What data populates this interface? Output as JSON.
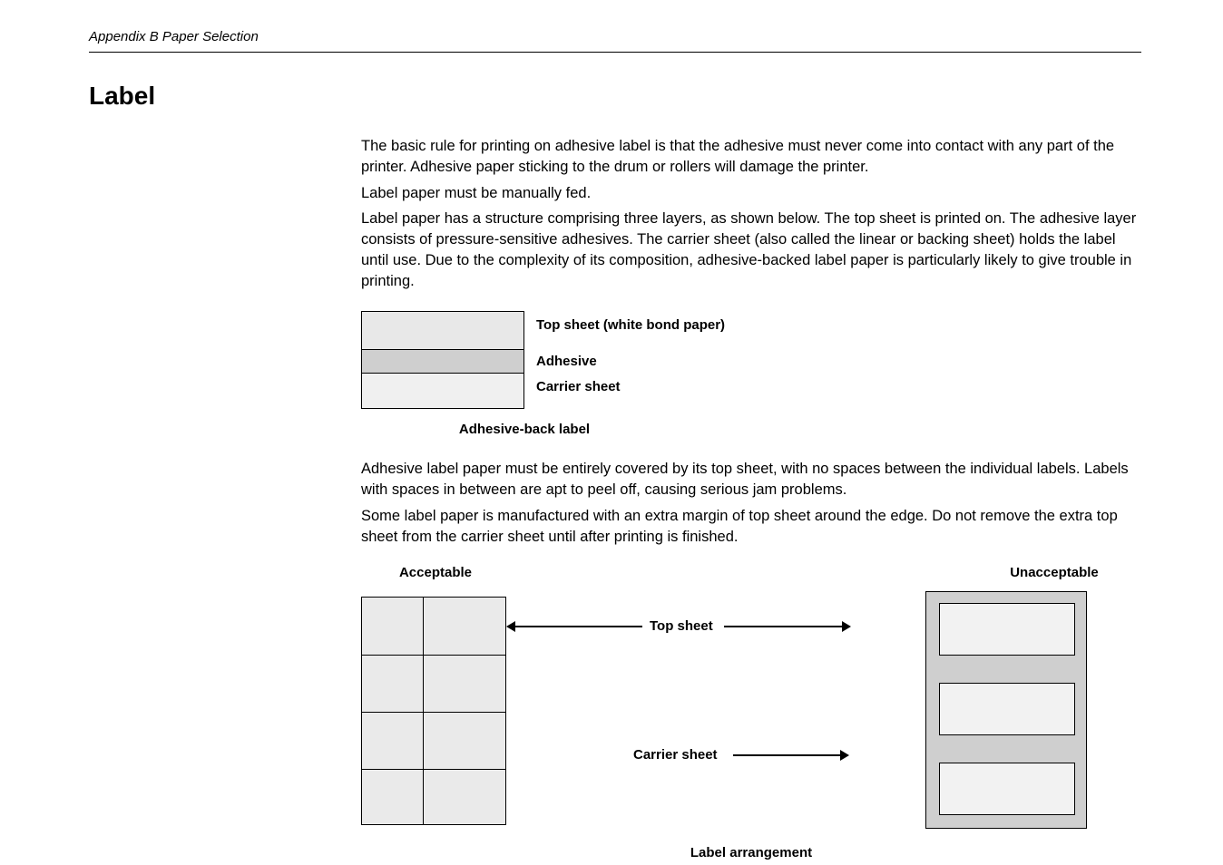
{
  "header": "Appendix B  Paper Selection",
  "section_title": "Label",
  "paragraphs": {
    "p1": "The basic rule for printing on adhesive label is that the adhesive must never come into contact with any part of the printer. Adhesive paper sticking to the drum or rollers will damage the printer.",
    "p2": "Label paper must be manually fed.",
    "p3": "Label paper has a structure comprising three layers, as shown below. The top sheet is printed on. The adhesive layer consists of pressure-sensitive adhesives. The carrier sheet (also called the linear or backing sheet) holds the label until use. Due to the complexity of its composition, adhesive-backed label paper is particularly likely to give trouble in printing.",
    "p4": "Adhesive label paper must be entirely covered by its top sheet, with no spaces between the individual labels. Labels with spaces in between are apt to peel off, causing serious jam problems.",
    "p5": "Some label paper is manufactured with an extra margin of top sheet around the edge. Do not remove the extra top sheet from the carrier sheet until after printing is finished."
  },
  "layers": {
    "top": "Top sheet (white bond paper)",
    "adhesive": "Adhesive",
    "carrier": "Carrier sheet",
    "caption": "Adhesive-back label"
  },
  "arrangement": {
    "acceptable": "Acceptable",
    "unacceptable": "Unacceptable",
    "top_sheet": "Top sheet",
    "carrier_sheet": "Carrier sheet",
    "caption": "Label arrangement"
  }
}
